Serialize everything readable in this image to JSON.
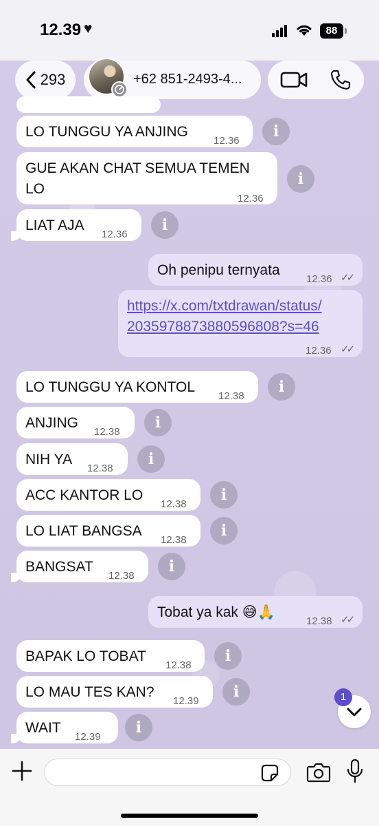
{
  "status_bar": {
    "time": "12.39",
    "battery": "88"
  },
  "header": {
    "back_count": "293",
    "contact_name": "+62 851-2493-4..."
  },
  "messages": [
    {
      "dir": "in",
      "text": "LO TUNGGU YA ANJING",
      "time": "12.36"
    },
    {
      "dir": "in",
      "text_line1": "GUE AKAN CHAT SEMUA TEMEN",
      "text_line2": "LO",
      "time": "12.36"
    },
    {
      "dir": "in",
      "text": "LIAT AJA",
      "time": "12.36"
    },
    {
      "dir": "out",
      "text": "Oh penipu ternyata",
      "time": "12.36"
    },
    {
      "dir": "out",
      "link_line1": "https://x.com/txtdrawan/status/",
      "link_line2": "2035978873880596808?s=46",
      "time": "12.36"
    },
    {
      "dir": "in",
      "text": "LO TUNGGU YA KONTOL",
      "time": "12.38"
    },
    {
      "dir": "in",
      "text": "ANJING",
      "time": "12.38"
    },
    {
      "dir": "in",
      "text": "NIH YA",
      "time": "12.38"
    },
    {
      "dir": "in",
      "text": "ACC KANTOR LO",
      "time": "12.38"
    },
    {
      "dir": "in",
      "text": "LO LIAT BANGSA",
      "time": "12.38"
    },
    {
      "dir": "in",
      "text": "BANGSAT",
      "time": "12.38"
    },
    {
      "dir": "out",
      "text": "Tobat ya kak 😅🙏",
      "time": "12.38"
    },
    {
      "dir": "in",
      "text": "BAPAK LO TOBAT",
      "time": "12.38"
    },
    {
      "dir": "in",
      "text": "LO MAU TES KAN?",
      "time": "12.39"
    },
    {
      "dir": "in",
      "text": "WAIT",
      "time": "12.39"
    }
  ],
  "scroll": {
    "unread_count": "1"
  },
  "composer": {
    "placeholder": ""
  },
  "colors": {
    "accent": "#5b4fc9",
    "chat_bg": "#cfc8e4",
    "outgoing_bubble": "#e6e1f7",
    "incoming_bubble": "#ffffff"
  }
}
